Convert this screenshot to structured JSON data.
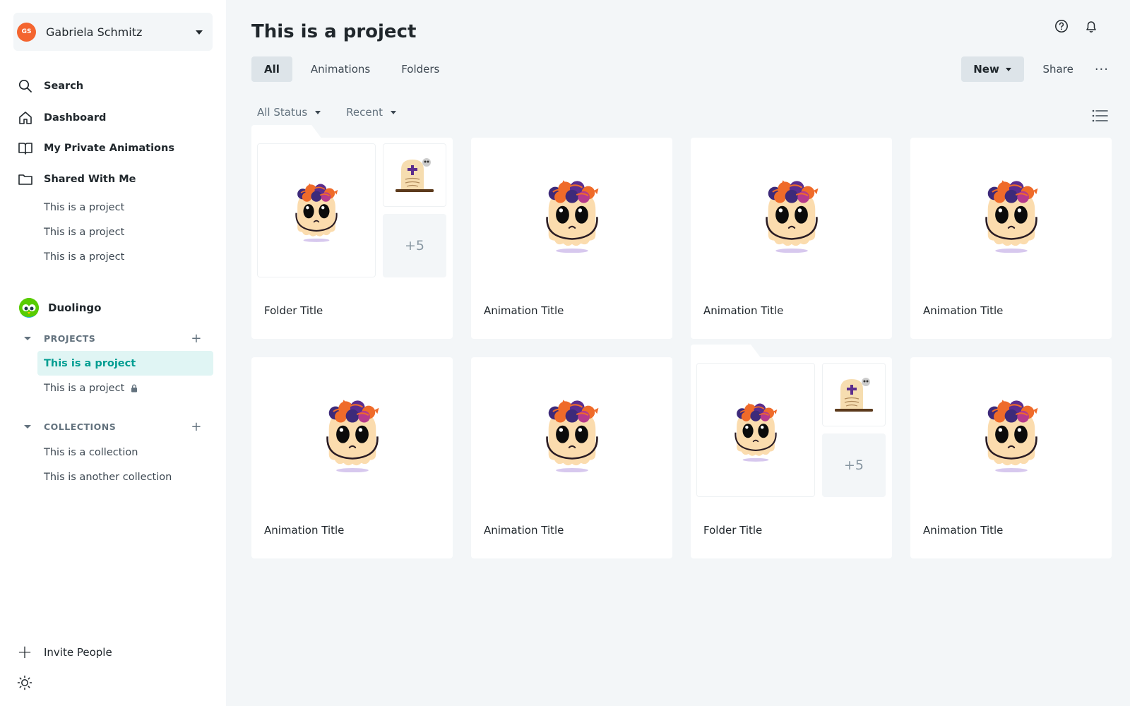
{
  "account": {
    "initials": "GS",
    "name": "Gabriela Schmitz"
  },
  "nav": {
    "search": "Search",
    "dashboard": "Dashboard",
    "private": "My Private Animations",
    "shared": "Shared With Me",
    "shared_items": [
      "This is a project",
      "This is a project",
      "This is a project"
    ]
  },
  "workspace": {
    "name": "Duolingo"
  },
  "projects": {
    "heading": "PROJECTS",
    "items": [
      "This is a project",
      "This is a project"
    ]
  },
  "collections": {
    "heading": "COLLECTIONS",
    "items": [
      "This is a collection",
      "This is another collection"
    ]
  },
  "footer": {
    "invite": "Invite People"
  },
  "header": {
    "title": "This is a project"
  },
  "tabs": [
    "All",
    "Animations",
    "Folders"
  ],
  "actions": {
    "new": "New",
    "share": "Share",
    "more": "···"
  },
  "filters": {
    "status": "All Status",
    "sort": "Recent"
  },
  "cards": [
    {
      "type": "folder",
      "title": "Folder Title",
      "count": "+5"
    },
    {
      "type": "animation",
      "title": "Animation Title"
    },
    {
      "type": "animation",
      "title": "Animation Title"
    },
    {
      "type": "animation",
      "title": "Animation Title"
    },
    {
      "type": "animation",
      "title": "Animation Title"
    },
    {
      "type": "animation",
      "title": "Animation Title"
    },
    {
      "type": "folder",
      "title": "Folder Title",
      "count": "+5"
    },
    {
      "type": "animation",
      "title": "Animation Title"
    }
  ],
  "colors": {
    "accent": "#019d91",
    "avatar": "#f4652f",
    "active_bg": "#e0f5f4"
  },
  "icons": [
    "search-icon",
    "home-icon",
    "book-icon",
    "folder-icon",
    "help-icon",
    "bell-icon",
    "list-view-icon",
    "plus-icon",
    "sun-icon",
    "lock-icon"
  ]
}
